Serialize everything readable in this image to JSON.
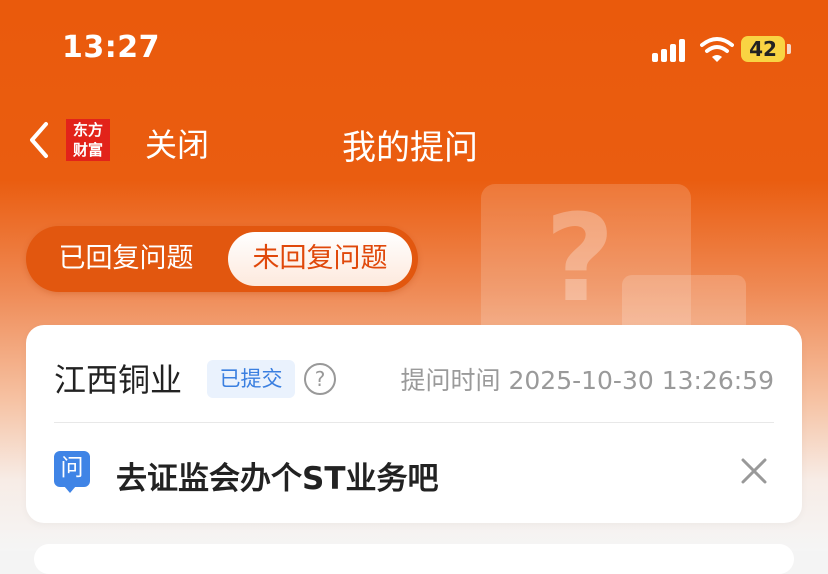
{
  "status_bar": {
    "time": "13:27",
    "battery": "42"
  },
  "nav": {
    "logo_line1": "东方",
    "logo_line2": "财富",
    "close_label": "关闭",
    "title": "我的提问"
  },
  "tabs": [
    {
      "label": "已回复问题"
    },
    {
      "label": "未回复问题",
      "active": true
    }
  ],
  "question": {
    "stock": "江西铜业",
    "status": "已提交",
    "help": "?",
    "time_label": "提问时间 2025-10-30 13:26:59",
    "q_badge": "问",
    "text": "去证监会办个ST业务吧"
  },
  "colors": {
    "brand": "#ea5a0c",
    "badge_blue": "#3f84e6",
    "battery": "#f9d443"
  }
}
